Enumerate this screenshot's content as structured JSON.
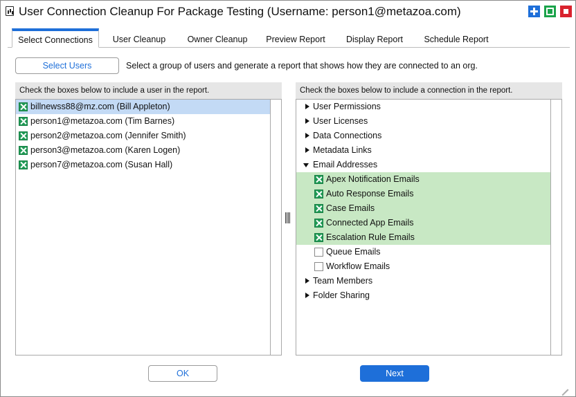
{
  "window": {
    "title": "User Connection Cleanup For Package Testing (Username: person1@metazoa.com)",
    "icon": "app-report-icon",
    "controls": [
      "maximize-icon",
      "restore-icon",
      "close-icon"
    ]
  },
  "tabs": [
    {
      "label": "Select Connections",
      "active": true
    },
    {
      "label": "User Cleanup",
      "active": false
    },
    {
      "label": "Owner Cleanup",
      "active": false
    },
    {
      "label": "Preview Report",
      "active": false
    },
    {
      "label": "Display Report",
      "active": false
    },
    {
      "label": "Schedule Report",
      "active": false
    }
  ],
  "toolbar": {
    "select_users_label": "Select Users",
    "hint": "Select a group of users and generate a report that shows how they are connected to an org."
  },
  "users_panel": {
    "header": "Check the boxes below to include a user in the report.",
    "items": [
      {
        "label": "billnewss88@mz.com (Bill Appleton)",
        "checked": true,
        "selected": true
      },
      {
        "label": "person1@metazoa.com (Tim Barnes)",
        "checked": true,
        "selected": false
      },
      {
        "label": "person2@metazoa.com (Jennifer Smith)",
        "checked": true,
        "selected": false
      },
      {
        "label": "person3@metazoa.com (Karen Logen)",
        "checked": true,
        "selected": false
      },
      {
        "label": "person7@metazoa.com (Susan Hall)",
        "checked": true,
        "selected": false
      }
    ]
  },
  "connections_panel": {
    "header": "Check the boxes below to include a connection in the report.",
    "groups": [
      {
        "label": "User Permissions",
        "expanded": false
      },
      {
        "label": "User Licenses",
        "expanded": false
      },
      {
        "label": "Data Connections",
        "expanded": false
      },
      {
        "label": "Metadata Links",
        "expanded": false
      },
      {
        "label": "Email Addresses",
        "expanded": true,
        "children": [
          {
            "label": "Apex Notification Emails",
            "checked": true
          },
          {
            "label": "Auto Response Emails",
            "checked": true
          },
          {
            "label": "Case Emails",
            "checked": true
          },
          {
            "label": "Connected App Emails",
            "checked": true
          },
          {
            "label": "Escalation Rule Emails",
            "checked": true
          },
          {
            "label": "Queue Emails",
            "checked": false
          },
          {
            "label": "Workflow Emails",
            "checked": false
          }
        ]
      },
      {
        "label": "Team Members",
        "expanded": false
      },
      {
        "label": "Folder Sharing",
        "expanded": false
      }
    ]
  },
  "footer": {
    "ok_label": "OK",
    "next_label": "Next"
  },
  "colors": {
    "accent": "#1e6fd9",
    "check_green": "#1f9a55",
    "selected_row": "#c3daf5",
    "checked_row": "#c8e8c4"
  }
}
